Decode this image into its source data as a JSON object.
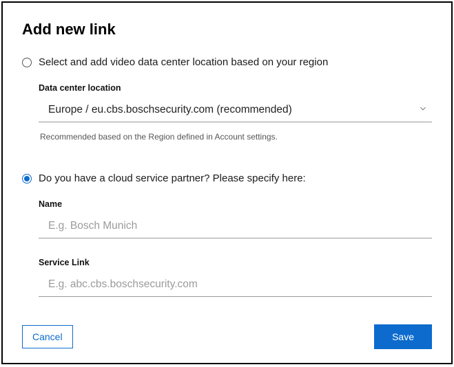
{
  "dialog": {
    "title": "Add new link"
  },
  "options": {
    "region": {
      "label": "Select and add video data center location based on your region",
      "selected": false,
      "data_center": {
        "label": "Data center location",
        "value": "Europe / eu.cbs.boschsecurity.com (recommended)",
        "helper": "Recommended based on the Region defined in Account settings."
      }
    },
    "partner": {
      "label": "Do you have a cloud service partner? Please specify here:",
      "selected": true,
      "name": {
        "label": "Name",
        "value": "",
        "placeholder": "E.g. Bosch Munich"
      },
      "service_link": {
        "label": "Service Link",
        "value": "",
        "placeholder": "E.g. abc.cbs.boschsecurity.com"
      }
    }
  },
  "footer": {
    "cancel": "Cancel",
    "save": "Save"
  }
}
